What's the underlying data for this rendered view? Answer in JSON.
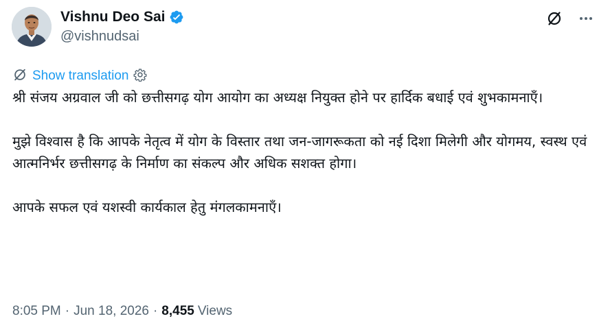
{
  "author": {
    "display_name": "Vishnu Deo Sai",
    "handle": "@vishnudsai",
    "verified": true,
    "verified_color": "#1d9bf0"
  },
  "header_actions": {
    "grok_icon": "grok-icon",
    "more_icon": "more-icon"
  },
  "translation": {
    "label": "Show translation",
    "link_color": "#1d9bf0"
  },
  "tweet": {
    "paragraphs": [
      "श्री संजय अग्रवाल जी को छत्तीसगढ़ योग आयोग का अध्यक्ष नियुक्त होने पर हार्दिक बधाई एवं शुभकामनाएँ।",
      "मुझे विश्वास है कि आपके नेतृत्व में योग के विस्तार तथा जन-जागरूकता को नई दिशा मिलेगी और योगमय, स्वस्थ एवं आत्मनिर्भर छत्तीसगढ़ के निर्माण का संकल्प और अधिक सशक्त होगा।",
      "आपके सफल एवं यशस्वी कार्यकाल हेतु मंगलकामनाएँ।"
    ]
  },
  "meta": {
    "time": "8:05 PM",
    "date": "Jun 18, 2026",
    "separator": "·",
    "views_count": "8,455",
    "views_label": "Views"
  }
}
